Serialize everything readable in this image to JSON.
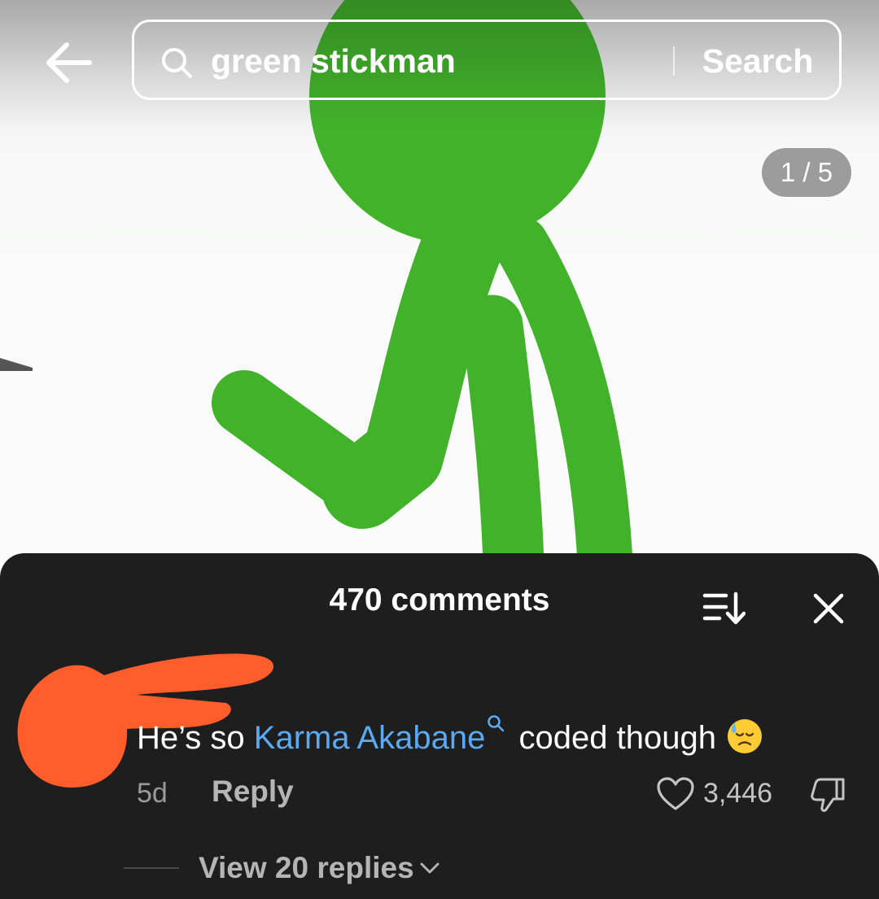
{
  "search": {
    "query": "green stickman",
    "button_label": "Search"
  },
  "media": {
    "page_counter": "1 / 5"
  },
  "comments": {
    "title": "470 comments",
    "items": [
      {
        "text_before": "He’s so ",
        "mention": "Karma Akabane",
        "text_after": " coded though",
        "emoji": "downcast-face-with-sweat-icon",
        "age": "5d",
        "reply_label": "Reply",
        "likes": "3,446",
        "view_replies": "View 20 replies"
      }
    ]
  },
  "colors": {
    "sheet_bg": "#1e1e1e",
    "mention": "#5aaaf3",
    "stickman": "#42b22b",
    "redaction": "#ff5e2c"
  }
}
